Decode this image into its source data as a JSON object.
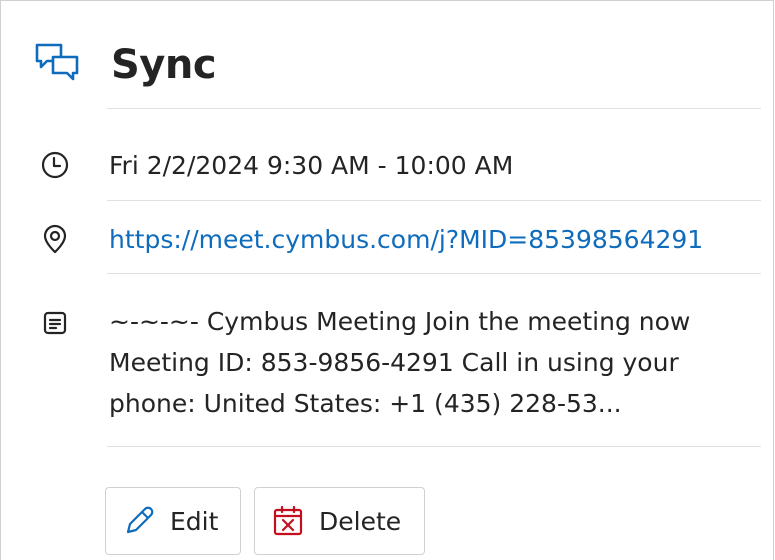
{
  "event": {
    "title": "Sync",
    "time": "Fri 2/2/2024 9:30 AM - 10:00 AM",
    "location_link": "https://meet.cymbus.com/j?MID=85398564291",
    "notes_line1": "~-~-~- Cymbus Meeting Join the meeting now",
    "notes_line2": "Meeting ID: 853-9856-4291 Call in using your",
    "notes_line3": "phone: United States: +1 (435) 228-53..."
  },
  "actions": {
    "edit_label": "Edit",
    "delete_label": "Delete"
  },
  "icons": {
    "header": "chat-bubbles-icon",
    "time": "clock-icon",
    "location": "location-pin-icon",
    "notes": "notes-icon",
    "edit": "pencil-icon",
    "delete": "calendar-delete-icon"
  },
  "colors": {
    "accent": "#0f6cbd",
    "delete_accent": "#c50f1f",
    "text": "#242424",
    "border": "#d1d1d1"
  }
}
